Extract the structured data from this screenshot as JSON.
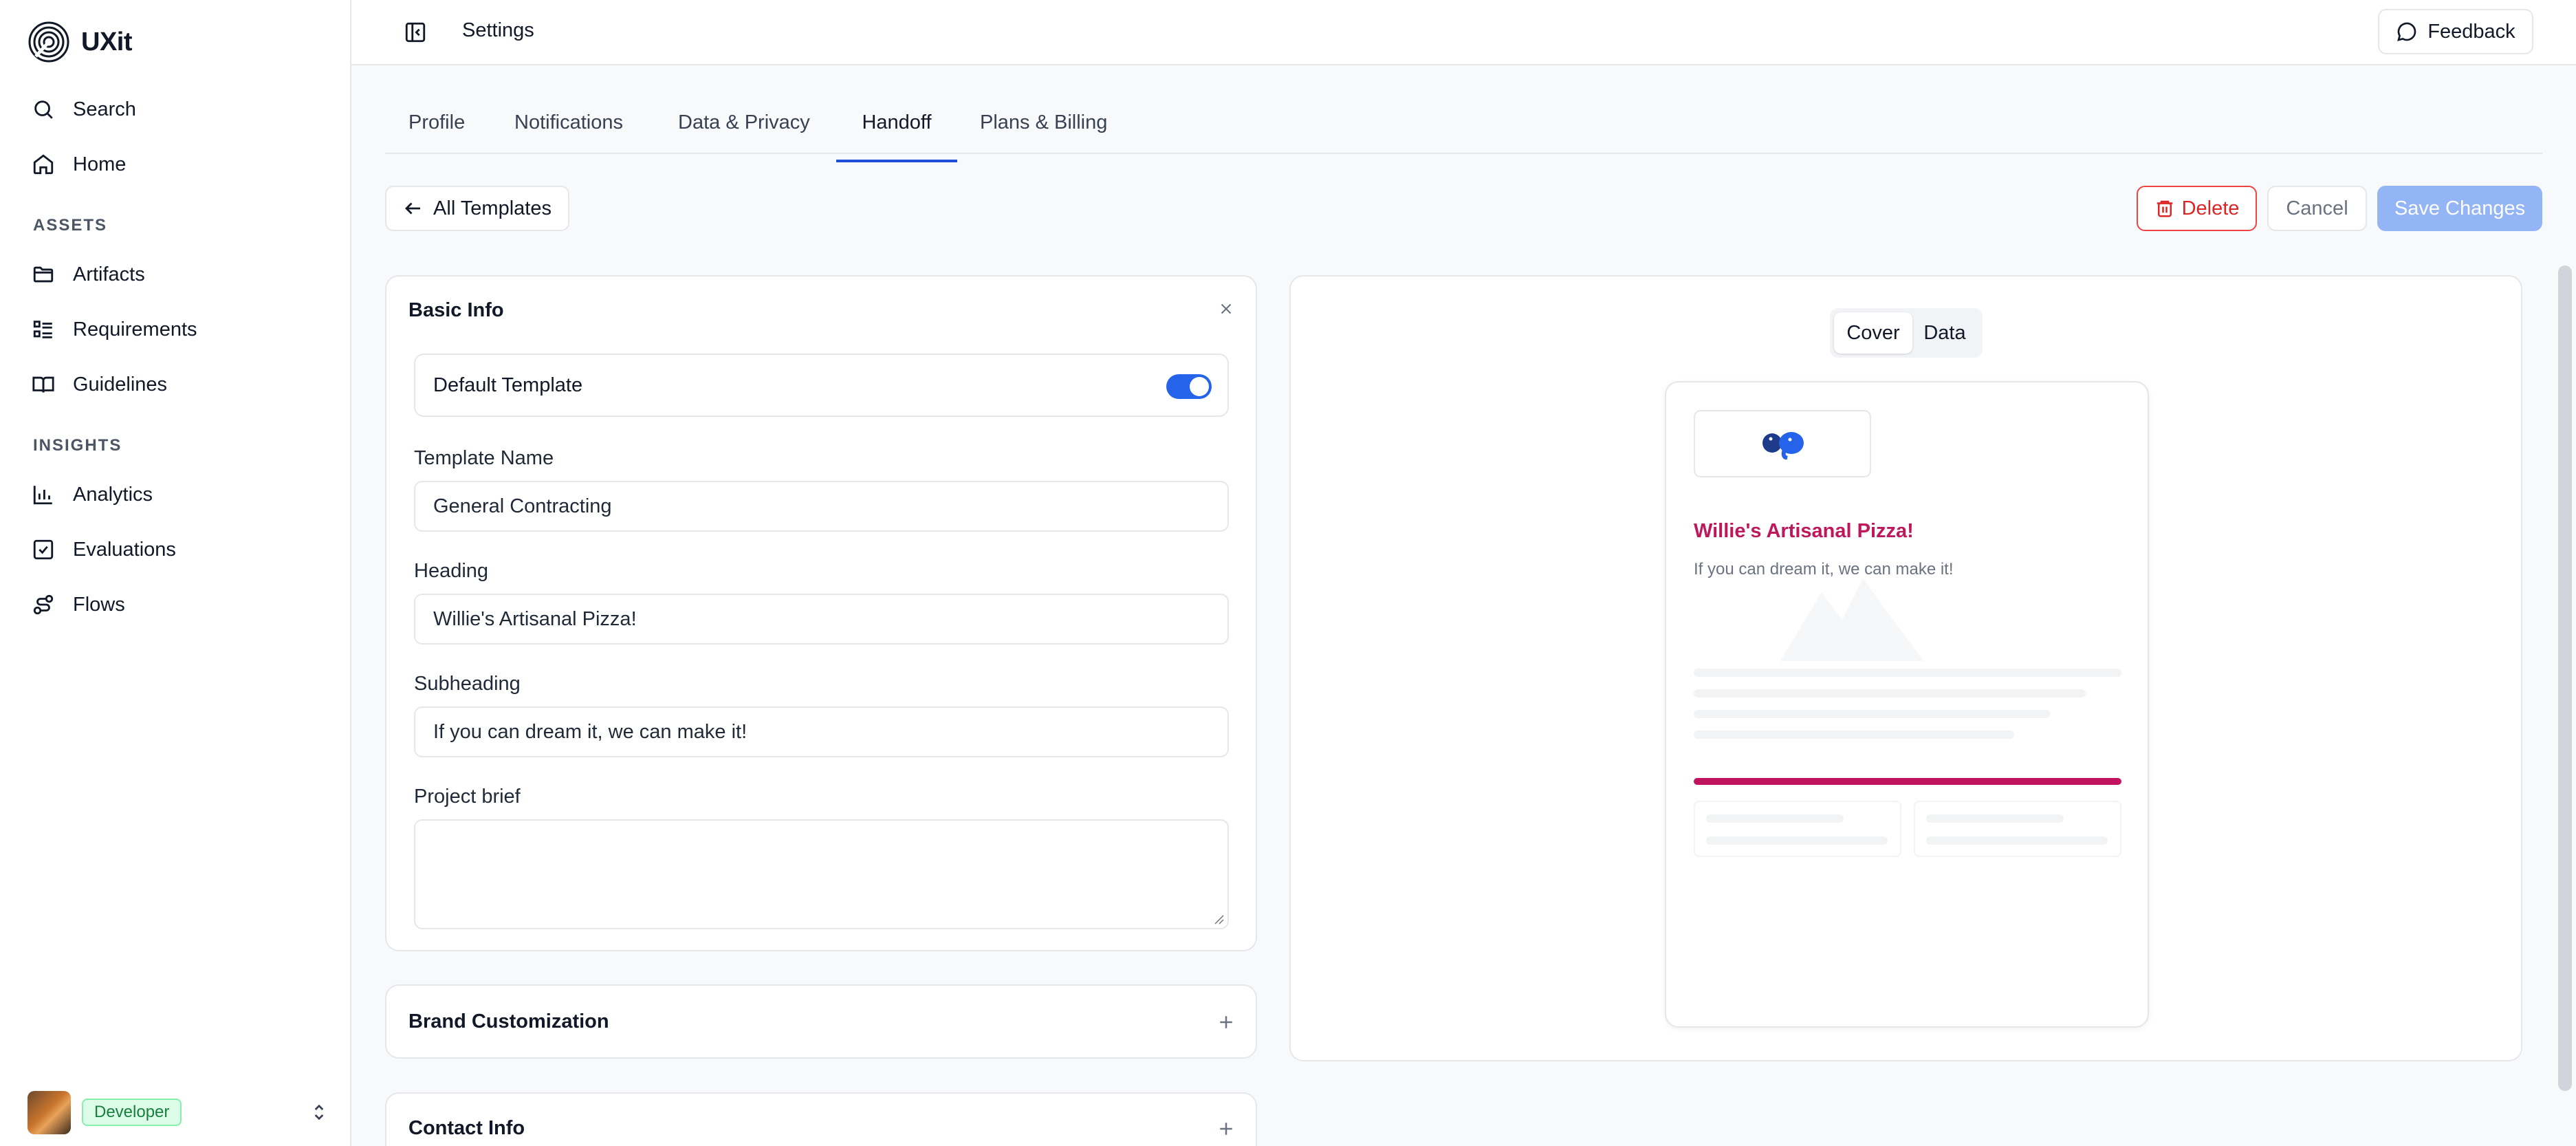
{
  "app": {
    "name": "UXit"
  },
  "colors": {
    "accent": "#2563eb",
    "brand_heading": "#be185d",
    "brand_bar": "#c0125f",
    "danger": "#dc2626",
    "save_disabled": "#93b4f5"
  },
  "sidebar": {
    "search": {
      "label": "Search",
      "icon": "search-icon"
    },
    "home": {
      "label": "Home",
      "icon": "home-icon"
    },
    "assets_label": "ASSETS",
    "assets": [
      {
        "label": "Artifacts",
        "icon": "folder-icon"
      },
      {
        "label": "Requirements",
        "icon": "list-icon"
      },
      {
        "label": "Guidelines",
        "icon": "book-icon"
      }
    ],
    "insights_label": "INSIGHTS",
    "insights": [
      {
        "label": "Analytics",
        "icon": "bar-chart-icon"
      },
      {
        "label": "Evaluations",
        "icon": "check-square-icon"
      },
      {
        "label": "Flows",
        "icon": "flow-icon"
      }
    ],
    "user": {
      "role": "Developer"
    }
  },
  "header": {
    "title": "Settings",
    "feedback_label": "Feedback"
  },
  "tabs": [
    {
      "label": "Profile",
      "active": false
    },
    {
      "label": "Notifications",
      "active": false
    },
    {
      "label": "Data & Privacy",
      "active": false
    },
    {
      "label": "Handoff",
      "active": true
    },
    {
      "label": "Plans & Billing",
      "active": false
    }
  ],
  "actions": {
    "back_label": "All Templates",
    "delete_label": "Delete",
    "cancel_label": "Cancel",
    "save_label": "Save Changes"
  },
  "basic_info": {
    "title": "Basic Info",
    "default_template_label": "Default Template",
    "default_template_on": true,
    "template_name_label": "Template Name",
    "template_name_value": "General Contracting",
    "heading_label": "Heading",
    "heading_value": "Willie's Artisanal Pizza!",
    "subheading_label": "Subheading",
    "subheading_value": "If you can dream it, we can make it!",
    "project_brief_label": "Project brief",
    "project_brief_value": ""
  },
  "sections": {
    "brand_title": "Brand Customization",
    "contact_title": "Contact Info"
  },
  "preview": {
    "tabs": [
      {
        "label": "Cover",
        "active": true
      },
      {
        "label": "Data",
        "active": false
      }
    ],
    "heading": "Willie's Artisanal Pizza!",
    "subheading": "If you can dream it, we can make it!"
  }
}
